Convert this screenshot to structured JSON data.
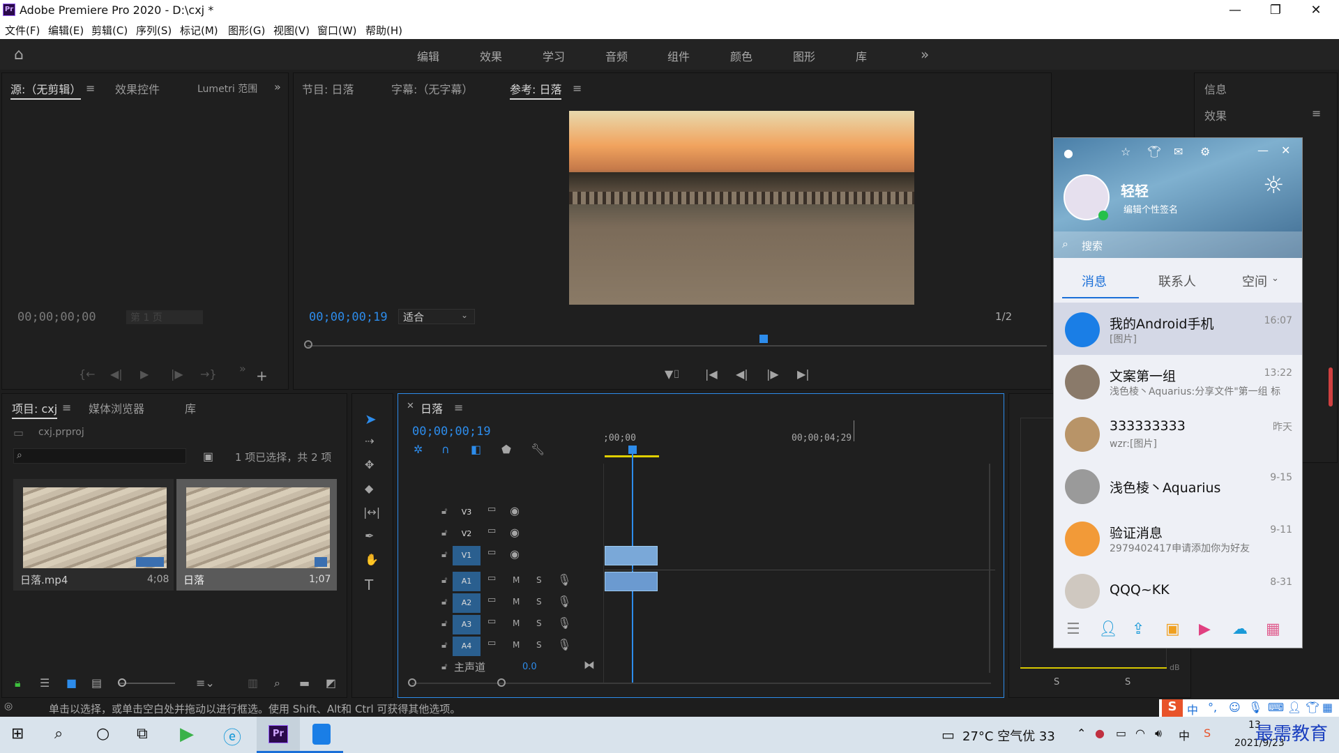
{
  "window": {
    "title": "Adobe Premiere Pro 2020 - D:\\cxj *",
    "logo": "Pr",
    "minimize": "—",
    "restore": "❐",
    "close": "✕"
  },
  "menu": [
    "文件(F)",
    "编辑(E)",
    "剪辑(C)",
    "序列(S)",
    "标记(M)",
    "图形(G)",
    "视图(V)",
    "窗口(W)",
    "帮助(H)"
  ],
  "workspaces": [
    "编辑",
    "效果",
    "学习",
    "音频",
    "组件",
    "颜色",
    "图形",
    "库"
  ],
  "source_panel": {
    "tabs": [
      "源:（无剪辑）",
      "效果控件",
      "Lumetri 范围"
    ],
    "timecode": "00;00;00;00",
    "page": "第 1 页"
  },
  "program_panel": {
    "tabs": [
      "节目: 日落",
      "字幕:（无字幕）",
      "参考: 日落"
    ],
    "timecode": "00;00;00;19",
    "fit": "适合",
    "fraction": "1/2"
  },
  "right_panel": {
    "info": "信息",
    "effects": "效果"
  },
  "project_panel": {
    "tabs": [
      "项目: cxj",
      "媒体浏览器",
      "库"
    ],
    "file": "cxj.prproj",
    "selection": "1 项已选择，共 2 项",
    "items": [
      {
        "name": "日落.mp4",
        "duration": "4;08"
      },
      {
        "name": "日落",
        "duration": "1;07"
      }
    ]
  },
  "timeline": {
    "name": "日落",
    "timecode": "00;00;00;19",
    "ruler": [
      ";00;00",
      "00;00;04;29"
    ],
    "video_tracks": [
      "V3",
      "V2",
      "V1"
    ],
    "audio_tracks": [
      "A1",
      "A2",
      "A3",
      "A4"
    ],
    "master": "主声道",
    "master_value": "0.0",
    "m": "M",
    "s": "S"
  },
  "meter": {
    "db": "dB",
    "s1": "S",
    "s2": "S"
  },
  "status": "单击以选择，或单击空白处并拖动以进行框选。使用 Shift、Alt和 Ctrl 可获得其他选项。",
  "qq": {
    "nickname": "轻轻",
    "signature": "编辑个性签名",
    "search": "搜索",
    "tabs": [
      "消息",
      "联系人",
      "空间"
    ],
    "chats": [
      {
        "name": "我的Android手机",
        "msg": "[图片]",
        "time": "16:07"
      },
      {
        "name": "文案第一组",
        "msg": "浅色棱丶Aquarius:分享文件\"第一组 标",
        "time": "13:22"
      },
      {
        "name": "333333333",
        "msg": "wzr:[图片]",
        "time": "昨天"
      },
      {
        "name": "浅色棱丶Aquarius",
        "msg": "",
        "time": "9-15"
      },
      {
        "name": "验证消息",
        "msg": "2979402417申请添加你为好友",
        "time": "9-11"
      },
      {
        "name": "QQQ~KK",
        "msg": "",
        "time": "8-31"
      }
    ]
  },
  "taskbar": {
    "weather": "27°C 空气优 33",
    "ime": "中",
    "watermark": "最需教育",
    "date": "2021/9/23",
    "time": "13"
  }
}
